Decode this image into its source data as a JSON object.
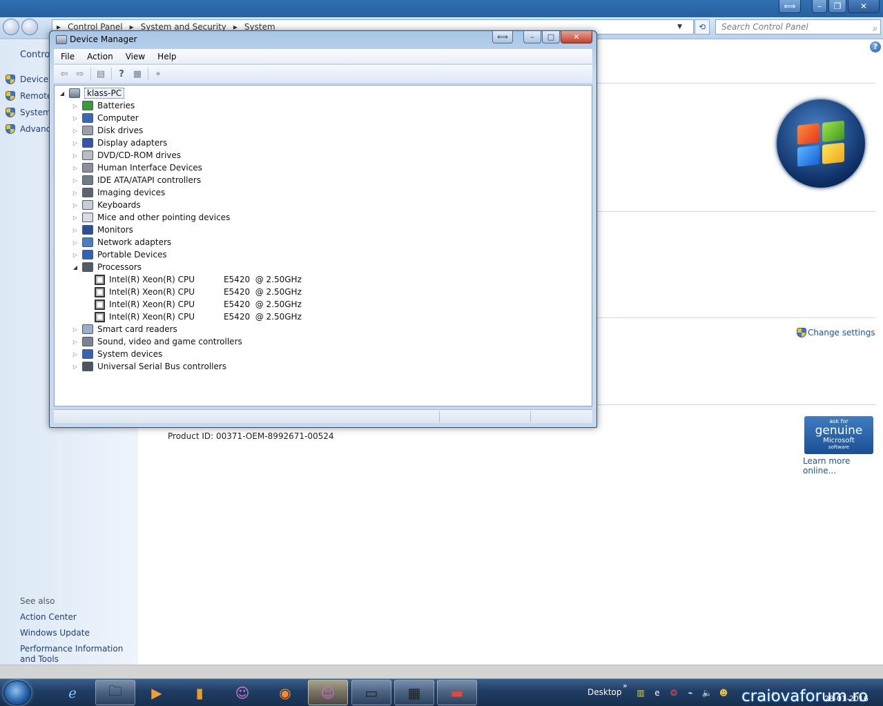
{
  "control_panel": {
    "breadcrumb": [
      "Control Panel",
      "System and Security",
      "System"
    ],
    "search_placeholder": "Search Control Panel",
    "home_label": "Control",
    "tasks": [
      "Device M",
      "Remote",
      "System",
      "Advanc"
    ],
    "see_also_heading": "See also",
    "see_also_links": [
      "Action Center",
      "Windows Update",
      "Performance Information and Tools"
    ],
    "change_settings": "Change settings",
    "product_id": "Product ID: 00371-OEM-8992671-00524",
    "genuine": {
      "line1": "ask for",
      "line2": "genuine",
      "line3": "Microsoft",
      "line4": "software"
    },
    "learn_more": "Learn more online..."
  },
  "device_manager": {
    "title": "Device Manager",
    "menu": [
      "File",
      "Action",
      "View",
      "Help"
    ],
    "root": "klass-PC",
    "categories": [
      {
        "label": "Batteries",
        "color": "#3a9a3a"
      },
      {
        "label": "Computer",
        "color": "#3a68b8"
      },
      {
        "label": "Disk drives",
        "color": "#9aa0a8"
      },
      {
        "label": "Display adapters",
        "color": "#3456a8"
      },
      {
        "label": "DVD/CD-ROM drives",
        "color": "#b8bcc4"
      },
      {
        "label": "Human Interface Devices",
        "color": "#8a8f99"
      },
      {
        "label": "IDE ATA/ATAPI controllers",
        "color": "#6f7c8c"
      },
      {
        "label": "Imaging devices",
        "color": "#5d6470"
      },
      {
        "label": "Keyboards",
        "color": "#c9ccd2"
      },
      {
        "label": "Mice and other pointing devices",
        "color": "#d9dbe0"
      },
      {
        "label": "Monitors",
        "color": "#2d4f9a"
      },
      {
        "label": "Network adapters",
        "color": "#4a7fc0"
      },
      {
        "label": "Portable Devices",
        "color": "#2f62b0"
      },
      {
        "label": "Processors",
        "color": "#555b66"
      }
    ],
    "processors": [
      "Intel(R) Xeon(R) CPU           E5420  @ 2.50GHz",
      "Intel(R) Xeon(R) CPU           E5420  @ 2.50GHz",
      "Intel(R) Xeon(R) CPU           E5420  @ 2.50GHz",
      "Intel(R) Xeon(R) CPU           E5420  @ 2.50GHz"
    ],
    "categories_after": [
      {
        "label": "Smart card readers",
        "color": "#9ab0c8"
      },
      {
        "label": "Sound, video and game controllers",
        "color": "#7a8391"
      },
      {
        "label": "System devices",
        "color": "#3a62ae"
      },
      {
        "label": "Universal Serial Bus controllers",
        "color": "#4f5560"
      }
    ]
  },
  "taskbar": {
    "desktop_label": "Desktop",
    "date": "28-01-2016",
    "watermark": "craiovaforum.ro"
  }
}
